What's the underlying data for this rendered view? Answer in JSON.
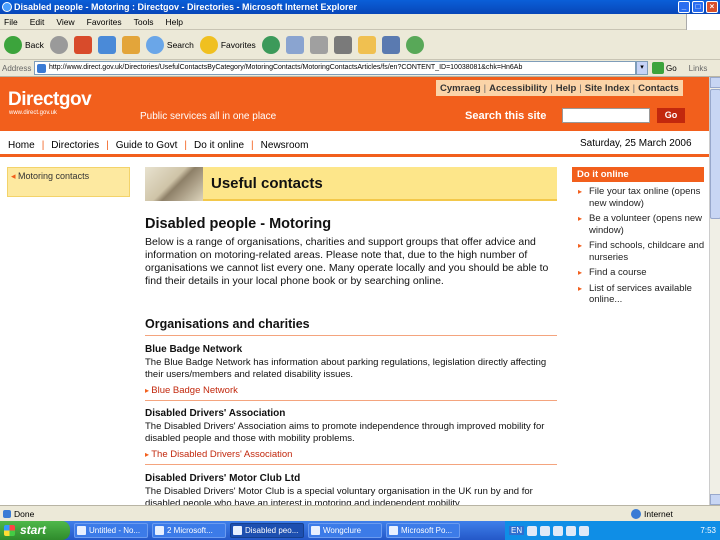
{
  "window": {
    "title": "Disabled people - Motoring : Directgov - Directories - Microsoft Internet Explorer"
  },
  "menu": [
    "File",
    "Edit",
    "View",
    "Favorites",
    "Tools",
    "Help"
  ],
  "toolbar": {
    "back": "Back",
    "search": "Search",
    "favorites": "Favorites"
  },
  "address": {
    "label": "Address",
    "url": "http://www.direct.gov.uk/Directories/UsefulContactsByCategory/MotoringContacts/MotoringContactsArticles/fs/en?CONTENT_ID=10038081&chk=Hn6Ab",
    "go": "Go",
    "links": "Links"
  },
  "site": {
    "logo": "Directgov",
    "logo_sub": "www.direct.gov.uk",
    "tagline": "Public services all in one place",
    "top_links": [
      "Cymraeg",
      "Accessibility",
      "Help",
      "Site Index",
      "Contacts"
    ],
    "search_label": "Search this site",
    "go_label": "Go",
    "nav": [
      "Home",
      "Directories",
      "Guide to Govt",
      "Do it online",
      "Newsroom"
    ],
    "date": "Saturday, 25 March 2006"
  },
  "left": {
    "item": "Motoring contacts"
  },
  "main": {
    "banner_title": "Useful contacts",
    "heading": "Disabled people - Motoring",
    "intro": "Below is a range of organisations, charities and support groups that offer advice and information on motoring-related areas. Please note that, due to the high number of organisations we cannot list every one. Many operate locally and you should be able to find their details in your local phone book or by searching online.",
    "section_heading": "Organisations and charities",
    "orgs": [
      {
        "name": "Blue Badge Network",
        "desc": "The Blue Badge Network has information about parking regulations, legislation directly affecting their users/members and related disability issues.",
        "link": "Blue Badge Network"
      },
      {
        "name": "Disabled Drivers' Association",
        "desc": "The Disabled Drivers' Association aims to promote independence through improved mobility for disabled people and those with mobility problems.",
        "link": "The Disabled Drivers' Association"
      },
      {
        "name": "Disabled Drivers' Motor Club Ltd",
        "desc": "The Disabled Drivers' Motor Club is a special voluntary organisation in the UK run by and for disabled people who have an interest in motoring and independent mobility."
      }
    ]
  },
  "right": {
    "heading": "Do it online",
    "items": [
      "File your tax online (opens new window)",
      "Be a volunteer (opens new window)",
      "Find schools, childcare and nurseries",
      "Find a course",
      "List of services available online..."
    ]
  },
  "status": {
    "text": "Done",
    "zone": "Internet"
  },
  "taskbar": {
    "start": "start",
    "tasks": [
      "Untitled - No...",
      "2 Microsoft...",
      "Disabled peo...",
      "Wongclure",
      "Microsoft Po..."
    ],
    "lang": "EN",
    "clock": "7:53"
  }
}
